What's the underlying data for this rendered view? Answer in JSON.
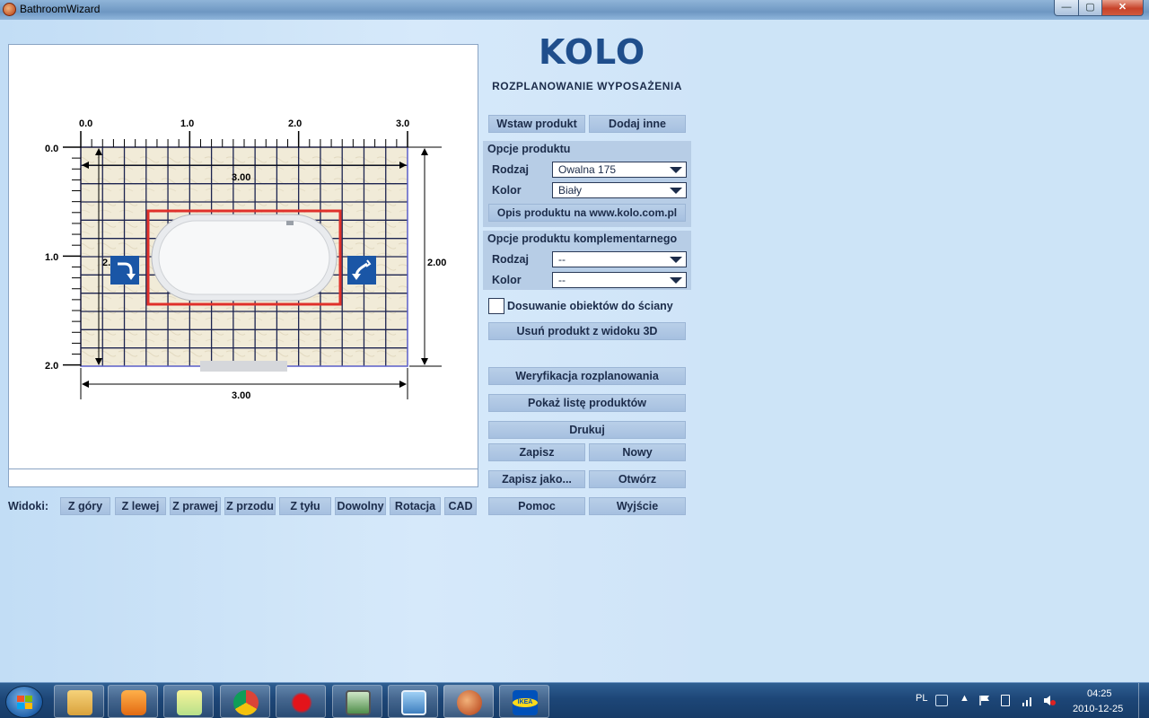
{
  "window": {
    "title": "BathroomWizard",
    "min": "—",
    "max": "▢",
    "close": "✕"
  },
  "logo": "KOLO",
  "subtitle": "ROZPLANOWANIE WYPOSAŻENIA",
  "top_buttons": {
    "insert": "Wstaw produkt",
    "add_other": "Dodaj inne"
  },
  "product_options": {
    "header": "Opcje produktu",
    "type_label": "Rodzaj",
    "type_value": "Owalna 175",
    "color_label": "Kolor",
    "color_value": "Biały",
    "link_button": "Opis produktu na www.kolo.com.pl"
  },
  "complementary_options": {
    "header": "Opcje produktu komplementarnego",
    "type_label": "Rodzaj",
    "type_value": "--",
    "color_label": "Kolor",
    "color_value": "--"
  },
  "wall_snap_label": "Dosuwanie obiektów do ściany",
  "buttons": {
    "remove_3d": "Usuń produkt z widoku 3D",
    "verify": "Weryfikacja rozplanowania",
    "list": "Pokaż listę produktów",
    "print": "Drukuj",
    "save": "Zapisz",
    "new": "Nowy",
    "save_as": "Zapisz jako...",
    "open": "Otwórz",
    "help": "Pomoc",
    "exit": "Wyjście"
  },
  "views": {
    "label": "Widoki:",
    "items": [
      "Z góry",
      "Z lewej",
      "Z prawej",
      "Z przodu",
      "Z tyłu",
      "Dowolny",
      "Rotacja",
      "CAD"
    ]
  },
  "plan": {
    "ruler_x": [
      "0.0",
      "1.0",
      "2.0",
      "3.0"
    ],
    "ruler_y": [
      "0.0",
      "1.0",
      "2.0"
    ],
    "dim_top": "3.00",
    "dim_bottom": "3.00",
    "dim_right": "2.00",
    "dim_left": "2.00",
    "room_width_m": 3.0,
    "room_depth_m": 2.0
  },
  "taskbar": {
    "language": "PL",
    "time": "04:25",
    "date": "2010-12-25",
    "apps": [
      "file-explorer-icon",
      "media-player-icon",
      "sticky-notes-icon",
      "chrome-icon",
      "paint-splash-icon",
      "monitor-app-icon",
      "control-panel-icon",
      "dj-app-icon",
      "ikea-icon"
    ],
    "ikea_text": "IKEA"
  },
  "colors": {
    "accent": "#1f4e8c",
    "selection": "#e0302a",
    "grid": "#1c2450",
    "floor": "#f2ecd9"
  }
}
